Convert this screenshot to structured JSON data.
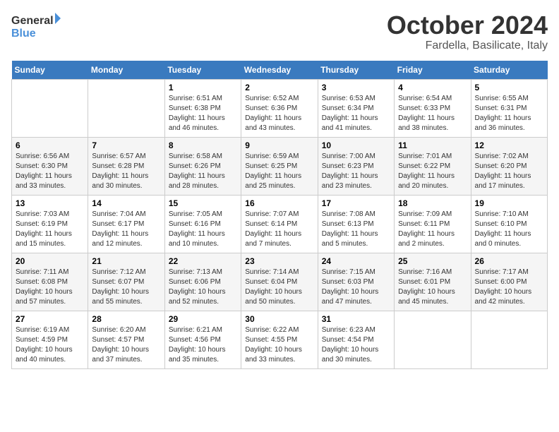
{
  "header": {
    "logo_line1": "General",
    "logo_line2": "Blue",
    "title": "October 2024",
    "subtitle": "Fardella, Basilicate, Italy"
  },
  "days_of_week": [
    "Sunday",
    "Monday",
    "Tuesday",
    "Wednesday",
    "Thursday",
    "Friday",
    "Saturday"
  ],
  "weeks": [
    [
      {
        "num": "",
        "detail": ""
      },
      {
        "num": "",
        "detail": ""
      },
      {
        "num": "1",
        "detail": "Sunrise: 6:51 AM\nSunset: 6:38 PM\nDaylight: 11 hours and 46 minutes."
      },
      {
        "num": "2",
        "detail": "Sunrise: 6:52 AM\nSunset: 6:36 PM\nDaylight: 11 hours and 43 minutes."
      },
      {
        "num": "3",
        "detail": "Sunrise: 6:53 AM\nSunset: 6:34 PM\nDaylight: 11 hours and 41 minutes."
      },
      {
        "num": "4",
        "detail": "Sunrise: 6:54 AM\nSunset: 6:33 PM\nDaylight: 11 hours and 38 minutes."
      },
      {
        "num": "5",
        "detail": "Sunrise: 6:55 AM\nSunset: 6:31 PM\nDaylight: 11 hours and 36 minutes."
      }
    ],
    [
      {
        "num": "6",
        "detail": "Sunrise: 6:56 AM\nSunset: 6:30 PM\nDaylight: 11 hours and 33 minutes."
      },
      {
        "num": "7",
        "detail": "Sunrise: 6:57 AM\nSunset: 6:28 PM\nDaylight: 11 hours and 30 minutes."
      },
      {
        "num": "8",
        "detail": "Sunrise: 6:58 AM\nSunset: 6:26 PM\nDaylight: 11 hours and 28 minutes."
      },
      {
        "num": "9",
        "detail": "Sunrise: 6:59 AM\nSunset: 6:25 PM\nDaylight: 11 hours and 25 minutes."
      },
      {
        "num": "10",
        "detail": "Sunrise: 7:00 AM\nSunset: 6:23 PM\nDaylight: 11 hours and 23 minutes."
      },
      {
        "num": "11",
        "detail": "Sunrise: 7:01 AM\nSunset: 6:22 PM\nDaylight: 11 hours and 20 minutes."
      },
      {
        "num": "12",
        "detail": "Sunrise: 7:02 AM\nSunset: 6:20 PM\nDaylight: 11 hours and 17 minutes."
      }
    ],
    [
      {
        "num": "13",
        "detail": "Sunrise: 7:03 AM\nSunset: 6:19 PM\nDaylight: 11 hours and 15 minutes."
      },
      {
        "num": "14",
        "detail": "Sunrise: 7:04 AM\nSunset: 6:17 PM\nDaylight: 11 hours and 12 minutes."
      },
      {
        "num": "15",
        "detail": "Sunrise: 7:05 AM\nSunset: 6:16 PM\nDaylight: 11 hours and 10 minutes."
      },
      {
        "num": "16",
        "detail": "Sunrise: 7:07 AM\nSunset: 6:14 PM\nDaylight: 11 hours and 7 minutes."
      },
      {
        "num": "17",
        "detail": "Sunrise: 7:08 AM\nSunset: 6:13 PM\nDaylight: 11 hours and 5 minutes."
      },
      {
        "num": "18",
        "detail": "Sunrise: 7:09 AM\nSunset: 6:11 PM\nDaylight: 11 hours and 2 minutes."
      },
      {
        "num": "19",
        "detail": "Sunrise: 7:10 AM\nSunset: 6:10 PM\nDaylight: 11 hours and 0 minutes."
      }
    ],
    [
      {
        "num": "20",
        "detail": "Sunrise: 7:11 AM\nSunset: 6:08 PM\nDaylight: 10 hours and 57 minutes."
      },
      {
        "num": "21",
        "detail": "Sunrise: 7:12 AM\nSunset: 6:07 PM\nDaylight: 10 hours and 55 minutes."
      },
      {
        "num": "22",
        "detail": "Sunrise: 7:13 AM\nSunset: 6:06 PM\nDaylight: 10 hours and 52 minutes."
      },
      {
        "num": "23",
        "detail": "Sunrise: 7:14 AM\nSunset: 6:04 PM\nDaylight: 10 hours and 50 minutes."
      },
      {
        "num": "24",
        "detail": "Sunrise: 7:15 AM\nSunset: 6:03 PM\nDaylight: 10 hours and 47 minutes."
      },
      {
        "num": "25",
        "detail": "Sunrise: 7:16 AM\nSunset: 6:01 PM\nDaylight: 10 hours and 45 minutes."
      },
      {
        "num": "26",
        "detail": "Sunrise: 7:17 AM\nSunset: 6:00 PM\nDaylight: 10 hours and 42 minutes."
      }
    ],
    [
      {
        "num": "27",
        "detail": "Sunrise: 6:19 AM\nSunset: 4:59 PM\nDaylight: 10 hours and 40 minutes."
      },
      {
        "num": "28",
        "detail": "Sunrise: 6:20 AM\nSunset: 4:57 PM\nDaylight: 10 hours and 37 minutes."
      },
      {
        "num": "29",
        "detail": "Sunrise: 6:21 AM\nSunset: 4:56 PM\nDaylight: 10 hours and 35 minutes."
      },
      {
        "num": "30",
        "detail": "Sunrise: 6:22 AM\nSunset: 4:55 PM\nDaylight: 10 hours and 33 minutes."
      },
      {
        "num": "31",
        "detail": "Sunrise: 6:23 AM\nSunset: 4:54 PM\nDaylight: 10 hours and 30 minutes."
      },
      {
        "num": "",
        "detail": ""
      },
      {
        "num": "",
        "detail": ""
      }
    ]
  ]
}
